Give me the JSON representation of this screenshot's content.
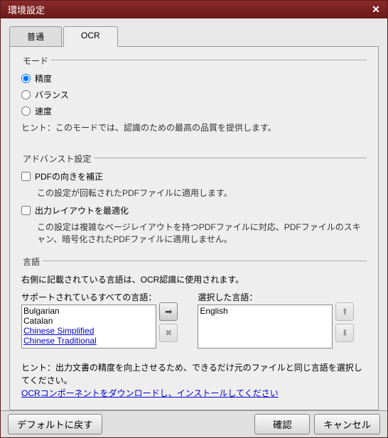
{
  "title": "環境設定",
  "tabs": {
    "normal": "普通",
    "ocr": "OCR"
  },
  "mode": {
    "legend": "モード",
    "options": {
      "accuracy": "精度",
      "balance": "バランス",
      "speed": "速度"
    },
    "hint": "ヒント：このモードでは、認識のための最高の品質を提供します。"
  },
  "advanced": {
    "legend": "アドバンスト設定",
    "pdfRotate": "PDFの向きを補正",
    "pdfRotateHint": "この設定が回転されたPDFファイルに適用します。",
    "layout": "出力レイアウトを最適化",
    "layoutHint": "この設定は複雑なページレイアウトを持つPDFファイルに対応、PDFファイルのスキャン、暗号化されたPDFファイルに適用しません。"
  },
  "language": {
    "legend": "言語",
    "desc": "右側に記載されている言語は、OCR認識に使用されます。",
    "supportedLabel": "サポートされているすべての言語：",
    "selectedLabel": "選択した言語：",
    "supported": [
      "Bulgarian",
      "Catalan",
      "Chinese Simplified",
      "Chinese Traditional"
    ],
    "selected": [
      "English"
    ],
    "bottomHint": "ヒント：出力文書の精度を向上させるため、できるだけ元のファイルと同じ言語を選択してください。",
    "downloadLink": "OCRコンポーネントをダウンロードし、インストールしてください"
  },
  "footer": {
    "restore": "デフォルトに戻す",
    "ok": "確認",
    "cancel": "キャンセル"
  },
  "icons": {
    "add": "➡",
    "remove": "✖",
    "up": "⬆",
    "down": "⬇"
  }
}
